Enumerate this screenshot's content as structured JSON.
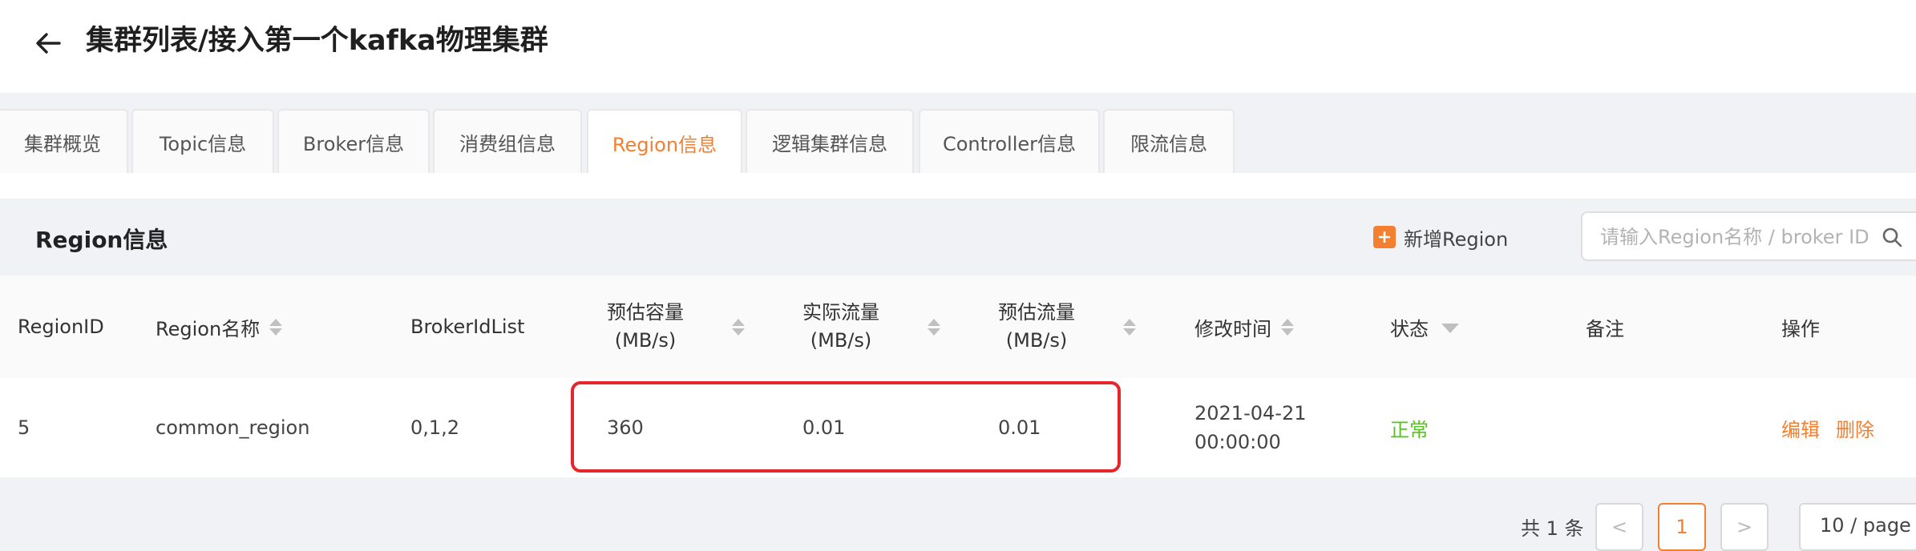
{
  "header": {
    "title": "集群列表/接入第一个kafka物理集群"
  },
  "tabs": [
    {
      "label": "集群概览",
      "active": false
    },
    {
      "label": "Topic信息",
      "active": false
    },
    {
      "label": "Broker信息",
      "active": false
    },
    {
      "label": "消费组信息",
      "active": false
    },
    {
      "label": "Region信息",
      "active": true
    },
    {
      "label": "逻辑集群信息",
      "active": false
    },
    {
      "label": "Controller信息",
      "active": false
    },
    {
      "label": "限流信息",
      "active": false
    }
  ],
  "panel": {
    "title": "Region信息",
    "add_button": "新增Region",
    "search_placeholder": "请输入Region名称 / broker ID"
  },
  "table": {
    "headers": {
      "region_id": "RegionID",
      "region_name": "Region名称",
      "broker_list": "BrokerIdList",
      "est_capacity": [
        "预估容量",
        "(MB/s)"
      ],
      "actual_flow": [
        "实际流量",
        "(MB/s)"
      ],
      "est_flow": [
        "预估流量",
        "(MB/s)"
      ],
      "modified": "修改时间",
      "status": "状态",
      "remark": "备注",
      "actions": "操作"
    },
    "rows": [
      {
        "region_id": "5",
        "region_name": "common_region",
        "broker_list": "0,1,2",
        "est_capacity": "360",
        "actual_flow": "0.01",
        "est_flow": "0.01",
        "modified": [
          "2021-04-21",
          "00:00:00"
        ],
        "status": "正常",
        "remark": "",
        "edit": "编辑",
        "delete": "删除"
      }
    ]
  },
  "pagination": {
    "total": "共 1 条",
    "prev": "<",
    "current": "1",
    "next": ">",
    "page_size": "10 / page"
  },
  "colors": {
    "accent": "#f38031",
    "ok": "#52c41a",
    "highlight": "#e6262c"
  },
  "icons": {
    "back": "arrow-left-icon",
    "add": "plus-square-icon",
    "search": "search-icon",
    "filter": "filter-icon"
  }
}
